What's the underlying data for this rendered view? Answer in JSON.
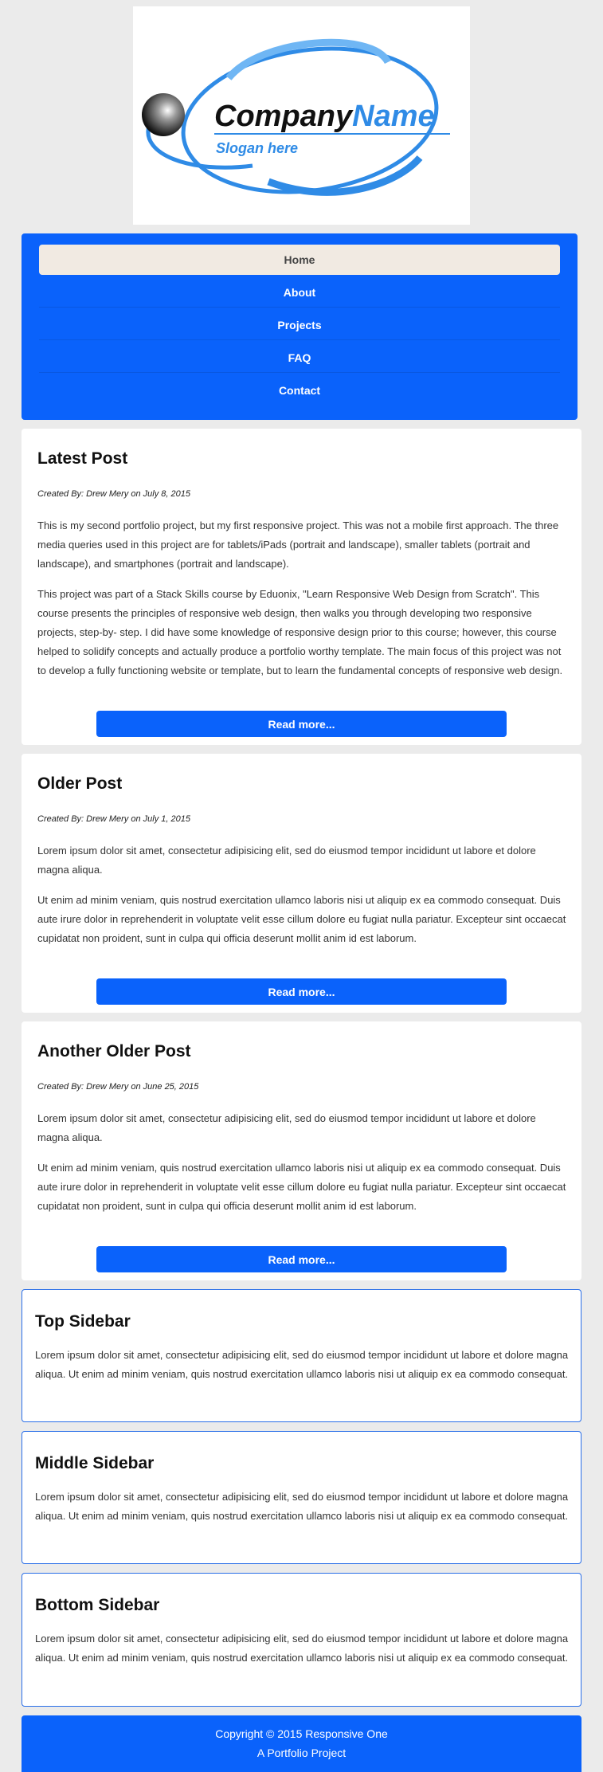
{
  "logo": {
    "company_part1": "Company",
    "company_part2": "Name",
    "slogan": "Slogan here"
  },
  "nav": {
    "items": [
      {
        "label": "Home",
        "active": true
      },
      {
        "label": "About",
        "active": false
      },
      {
        "label": "Projects",
        "active": false
      },
      {
        "label": "FAQ",
        "active": false
      },
      {
        "label": "Contact",
        "active": false
      }
    ]
  },
  "posts": [
    {
      "title": "Latest Post",
      "byline": "Created By: Drew Mery on July 8, 2015",
      "paragraphs": [
        "This is my second portfolio project, but my first responsive project. This was not a mobile first approach. The three media queries used in this project are for tablets/iPads (portrait and landscape), smaller tablets (portrait and landscape), and smartphones (portrait and landscape).",
        "This project was part of a Stack Skills course by Eduonix, \"Learn Responsive Web Design from Scratch\". This course presents the principles of responsive web design, then walks you through developing two responsive projects, step-by- step. I did have some knowledge of responsive design prior to this course; however, this course helped to solidify concepts and actually produce a portfolio worthy template. The main focus of this project was not to develop a fully functioning website or template, but to learn the fundamental concepts of responsive web design."
      ],
      "button": "Read more..."
    },
    {
      "title": "Older Post",
      "byline": "Created By: Drew Mery on July 1, 2015",
      "paragraphs": [
        "Lorem ipsum dolor sit amet, consectetur adipisicing elit, sed do eiusmod tempor incididunt ut labore et dolore magna aliqua.",
        "Ut enim ad minim veniam, quis nostrud exercitation ullamco laboris nisi ut aliquip ex ea commodo consequat. Duis aute irure dolor in reprehenderit in voluptate velit esse cillum dolore eu fugiat nulla pariatur. Excepteur sint occaecat cupidatat non proident, sunt in culpa qui officia deserunt mollit anim id est laborum."
      ],
      "button": "Read more..."
    },
    {
      "title": "Another Older Post",
      "byline": "Created By: Drew Mery on June 25, 2015",
      "paragraphs": [
        "Lorem ipsum dolor sit amet, consectetur adipisicing elit, sed do eiusmod tempor incididunt ut labore et dolore magna aliqua.",
        "Ut enim ad minim veniam, quis nostrud exercitation ullamco laboris nisi ut aliquip ex ea commodo consequat. Duis aute irure dolor in reprehenderit in voluptate velit esse cillum dolore eu fugiat nulla pariatur. Excepteur sint occaecat cupidatat non proident, sunt in culpa qui officia deserunt mollit anim id est laborum."
      ],
      "button": "Read more..."
    }
  ],
  "sidebars": [
    {
      "title": "Top Sidebar",
      "text": "Lorem ipsum dolor sit amet, consectetur adipisicing elit, sed do eiusmod tempor incididunt ut labore et dolore magna aliqua. Ut enim ad minim veniam, quis nostrud exercitation ullamco laboris nisi ut aliquip ex ea commodo consequat."
    },
    {
      "title": "Middle Sidebar",
      "text": "Lorem ipsum dolor sit amet, consectetur adipisicing elit, sed do eiusmod tempor incididunt ut labore et dolore magna aliqua. Ut enim ad minim veniam, quis nostrud exercitation ullamco laboris nisi ut aliquip ex ea commodo consequat."
    },
    {
      "title": "Bottom Sidebar",
      "text": "Lorem ipsum dolor sit amet, consectetur adipisicing elit, sed do eiusmod tempor incididunt ut labore et dolore magna aliqua. Ut enim ad minim veniam, quis nostrud exercitation ullamco laboris nisi ut aliquip ex ea commodo consequat."
    }
  ],
  "footer": {
    "copyright": "Copyright © 2015 Responsive One",
    "tagline": "A Portfolio Project"
  },
  "colors": {
    "accent": "#0a62fb",
    "active_nav_bg": "#f1eae2",
    "page_bg": "#ebebeb"
  }
}
